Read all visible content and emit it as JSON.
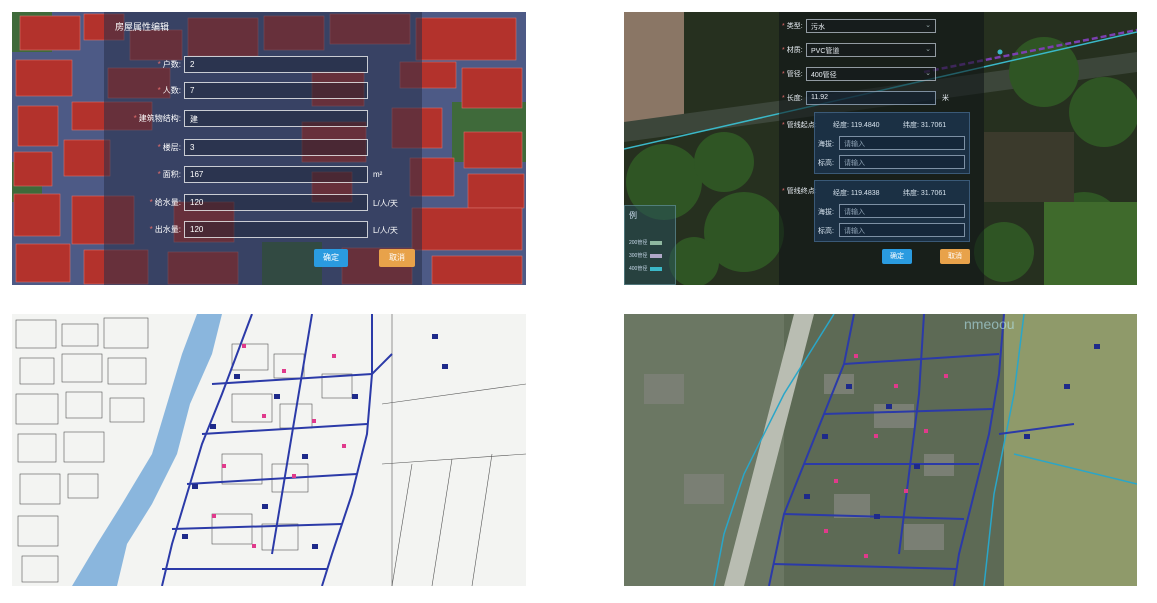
{
  "panel1": {
    "title": "房屋属性编辑",
    "fields": [
      {
        "required": "*",
        "label": "户数:",
        "value": "2",
        "unit": ""
      },
      {
        "required": "*",
        "label": "人数:",
        "value": "7",
        "unit": ""
      },
      {
        "required": "*",
        "label": "建筑物结构:",
        "value": "建",
        "unit": ""
      },
      {
        "required": "*",
        "label": "楼层:",
        "value": "3",
        "unit": ""
      },
      {
        "required": "*",
        "label": "面积:",
        "value": "167",
        "unit": "m²"
      },
      {
        "required": "*",
        "label": "给水量:",
        "value": "120",
        "unit": "L/人/天"
      },
      {
        "required": "*",
        "label": "出水量:",
        "value": "120",
        "unit": "L/人/天"
      }
    ],
    "ok_label": "确定",
    "cancel_label": "取消"
  },
  "panel2": {
    "type_label": "类型:",
    "type_value": "污水",
    "material_label": "材质:",
    "material_value": "PVC管道",
    "diameter_label": "管径:",
    "diameter_value": "400管径",
    "length_label": "长度:",
    "length_value": "11.92",
    "length_unit": "米",
    "start_label": "管线起点:",
    "start_lng": "经度: 119.4840",
    "start_lat": "纬度: 31.7061",
    "end_label": "管线终点:",
    "end_lng": "经度: 119.4838",
    "end_lat": "纬度: 31.7061",
    "elevation_label": "海拔:",
    "height_label": "标高:",
    "placeholder": "请输入",
    "legend_title": "例",
    "legend_items": [
      "200管径",
      "300管径",
      "400管径"
    ],
    "ok_label": "确定",
    "cancel_label": "取消",
    "colors": {
      "pipe": "#7b3fb0",
      "legend": [
        "#8fb8a0",
        "#b0a8c8",
        "#3bb8c8"
      ]
    }
  },
  "panel4": {
    "watermark": "nmeoou"
  }
}
